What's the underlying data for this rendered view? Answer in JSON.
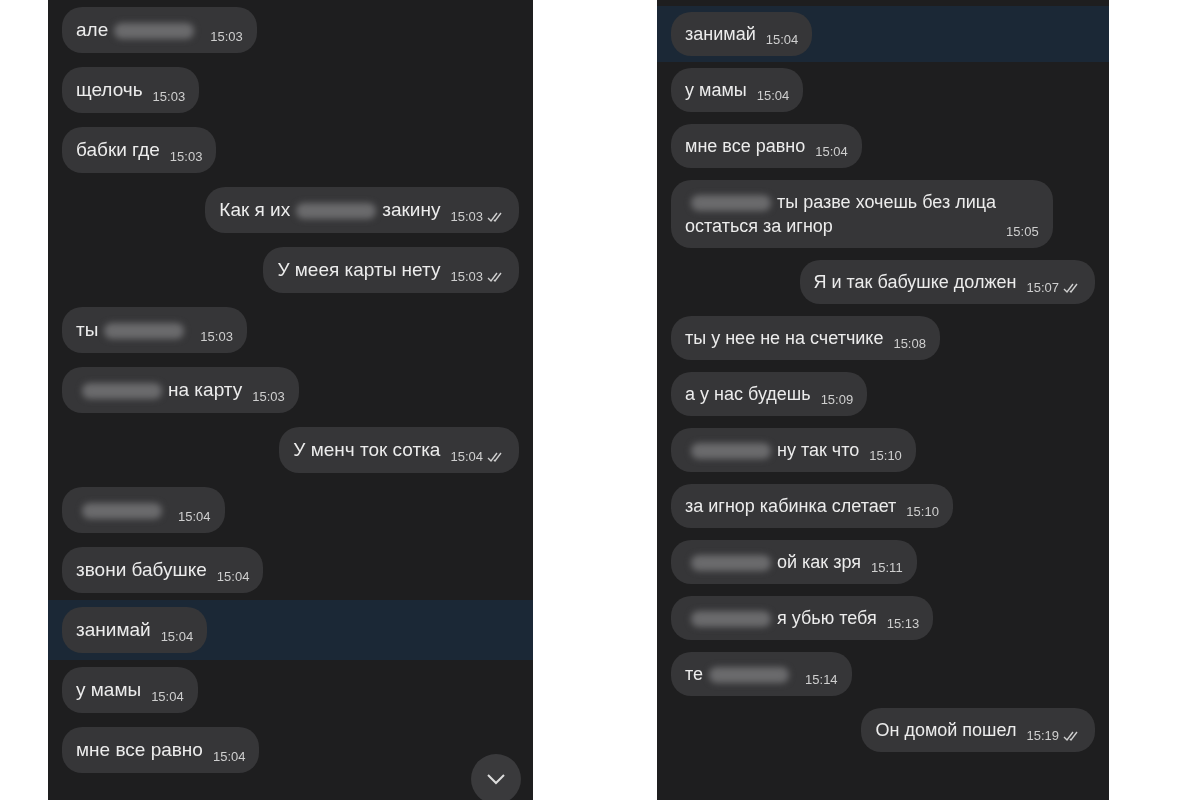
{
  "panels": [
    {
      "scroll_button": true,
      "messages": [
        {
          "outgoing": false,
          "highlighted": false,
          "time": "15:03",
          "parts": [
            {
              "kind": "text",
              "text": "але"
            },
            {
              "kind": "blur"
            }
          ]
        },
        {
          "outgoing": false,
          "highlighted": false,
          "time": "15:03",
          "parts": [
            {
              "kind": "text",
              "text": "щелочь"
            }
          ]
        },
        {
          "outgoing": false,
          "highlighted": false,
          "time": "15:03",
          "parts": [
            {
              "kind": "text",
              "text": "бабки где"
            }
          ]
        },
        {
          "outgoing": true,
          "highlighted": false,
          "read": true,
          "time": "15:03",
          "parts": [
            {
              "kind": "text",
              "text": "Как я их"
            },
            {
              "kind": "blur"
            },
            {
              "kind": "text",
              "text": "закину"
            }
          ]
        },
        {
          "outgoing": true,
          "highlighted": false,
          "read": true,
          "time": "15:03",
          "parts": [
            {
              "kind": "text",
              "text": "У меея карты нету"
            }
          ]
        },
        {
          "outgoing": false,
          "highlighted": false,
          "time": "15:03",
          "parts": [
            {
              "kind": "text",
              "text": "ты"
            },
            {
              "kind": "blur"
            }
          ]
        },
        {
          "outgoing": false,
          "highlighted": false,
          "time": "15:03",
          "parts": [
            {
              "kind": "blur"
            },
            {
              "kind": "text",
              "text": "на карту"
            }
          ]
        },
        {
          "outgoing": true,
          "highlighted": false,
          "read": true,
          "time": "15:04",
          "parts": [
            {
              "kind": "text",
              "text": "У менч ток сотка"
            }
          ]
        },
        {
          "outgoing": false,
          "highlighted": false,
          "time": "15:04",
          "parts": [
            {
              "kind": "blur"
            }
          ]
        },
        {
          "outgoing": false,
          "highlighted": false,
          "time": "15:04",
          "parts": [
            {
              "kind": "text",
              "text": "звони бабушке"
            }
          ]
        },
        {
          "outgoing": false,
          "highlighted": true,
          "time": "15:04",
          "parts": [
            {
              "kind": "text",
              "text": "занимай"
            }
          ]
        },
        {
          "outgoing": false,
          "highlighted": false,
          "time": "15:04",
          "parts": [
            {
              "kind": "text",
              "text": "у мамы"
            }
          ]
        },
        {
          "outgoing": false,
          "highlighted": false,
          "time": "15:04",
          "parts": [
            {
              "kind": "text",
              "text": "мне все равно"
            }
          ]
        }
      ]
    },
    {
      "messages": [
        {
          "outgoing": false,
          "highlighted": true,
          "time": "15:04",
          "parts": [
            {
              "kind": "text",
              "text": "занимай"
            }
          ]
        },
        {
          "outgoing": false,
          "highlighted": false,
          "time": "15:04",
          "parts": [
            {
              "kind": "text",
              "text": "у мамы"
            }
          ]
        },
        {
          "outgoing": false,
          "highlighted": false,
          "time": "15:04",
          "parts": [
            {
              "kind": "text",
              "text": "мне все равно"
            }
          ]
        },
        {
          "outgoing": false,
          "highlighted": false,
          "time": "15:05",
          "parts": [
            {
              "kind": "blur"
            },
            {
              "kind": "text",
              "text": "ты разве хочешь без лица"
            },
            {
              "kind": "break"
            },
            {
              "kind": "text",
              "text": "остаться за игнор"
            }
          ]
        },
        {
          "outgoing": true,
          "highlighted": false,
          "read": true,
          "time": "15:07",
          "parts": [
            {
              "kind": "text",
              "text": "Я и так бабушке должен"
            }
          ]
        },
        {
          "outgoing": false,
          "highlighted": false,
          "time": "15:08",
          "parts": [
            {
              "kind": "text",
              "text": "ты у нее не на счетчике"
            }
          ]
        },
        {
          "outgoing": false,
          "highlighted": false,
          "time": "15:09",
          "parts": [
            {
              "kind": "text",
              "text": "а у нас будешь"
            }
          ]
        },
        {
          "outgoing": false,
          "highlighted": false,
          "time": "15:10",
          "parts": [
            {
              "kind": "blur"
            },
            {
              "kind": "text",
              "text": "ну так что"
            }
          ]
        },
        {
          "outgoing": false,
          "highlighted": false,
          "time": "15:10",
          "parts": [
            {
              "kind": "text",
              "text": "за игнор кабинка слетает"
            }
          ]
        },
        {
          "outgoing": false,
          "highlighted": false,
          "time": "15:11",
          "parts": [
            {
              "kind": "blur"
            },
            {
              "kind": "text",
              "text": "ой как зря"
            }
          ]
        },
        {
          "outgoing": false,
          "highlighted": false,
          "time": "15:13",
          "parts": [
            {
              "kind": "blur"
            },
            {
              "kind": "text",
              "text": "я убью тебя"
            }
          ]
        },
        {
          "outgoing": false,
          "highlighted": false,
          "time": "15:14",
          "parts": [
            {
              "kind": "text",
              "text": "те"
            },
            {
              "kind": "blur"
            }
          ]
        },
        {
          "outgoing": true,
          "highlighted": false,
          "read": true,
          "time": "15:19",
          "parts": [
            {
              "kind": "text",
              "text": "Он домой пошел"
            }
          ]
        }
      ]
    }
  ]
}
